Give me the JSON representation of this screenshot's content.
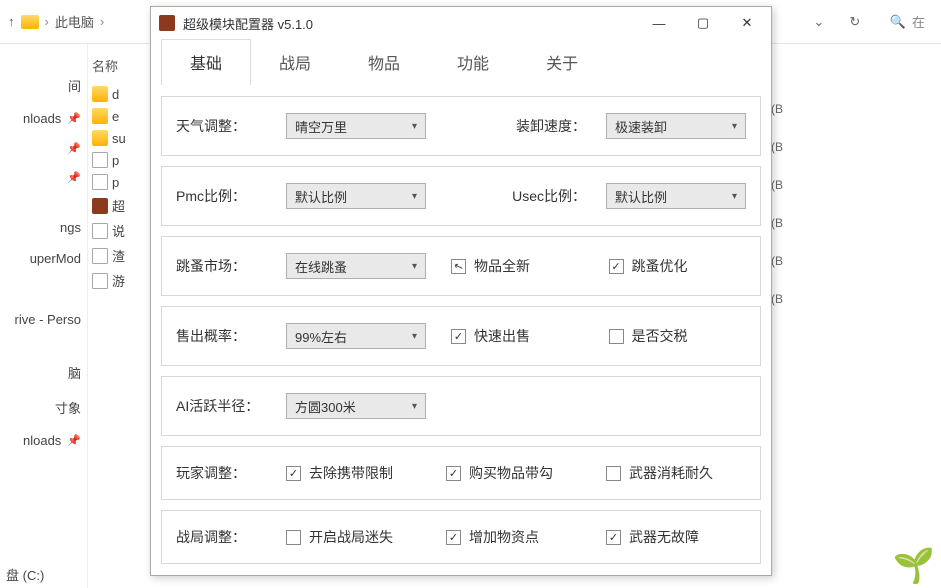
{
  "explorer": {
    "up_arrow": "↑",
    "breadcrumb": {
      "pc": "此电脑",
      "next": ""
    },
    "search_label": "在",
    "col_header": "名称",
    "files": [
      "d",
      "e",
      "su",
      "p",
      "p",
      "超",
      "说",
      "渣",
      "游"
    ],
    "right_col": [
      "(B",
      "(B",
      "(B",
      "(B",
      "(B",
      "(B"
    ],
    "nav": {
      "n1": "间",
      "n2": "nloads",
      "n3": "ngs",
      "n4": "uperMod",
      "n5": "rive - Perso",
      "n6": "脑",
      "n7": "寸象",
      "n8": "nloads"
    },
    "drive": "盘 (C:)"
  },
  "modal": {
    "title": "超级模块配置器 v5.1.0",
    "tabs": {
      "basic": "基础",
      "battle": "战局",
      "items": "物品",
      "func": "功能",
      "about": "关于"
    },
    "labels": {
      "weather": "天气调整：",
      "loadspeed": "装卸速度：",
      "pmc": "Pmc比例：",
      "usec": "Usec比例：",
      "market": "跳蚤市场：",
      "allnew": "物品全新",
      "optmarket": "跳蚤优化",
      "sellrate": "售出概率：",
      "fastsell": "快速出售",
      "tax": "是否交税",
      "airadius": "AI活跃半径：",
      "player": "玩家调整：",
      "nolimit": "去除携带限制",
      "buyhook": "购买物品带勾",
      "weapwear": "武器消耗耐久",
      "battleadj": "战局调整：",
      "maze": "开启战局迷失",
      "addpoints": "增加物资点",
      "weapok": "武器无故障"
    },
    "values": {
      "weather": "晴空万里",
      "loadspeed": "极速装卸",
      "pmc": "默认比例",
      "usec": "默认比例",
      "market": "在线跳蚤",
      "sellrate": "99%左右",
      "airadius": "方圆300米"
    }
  }
}
